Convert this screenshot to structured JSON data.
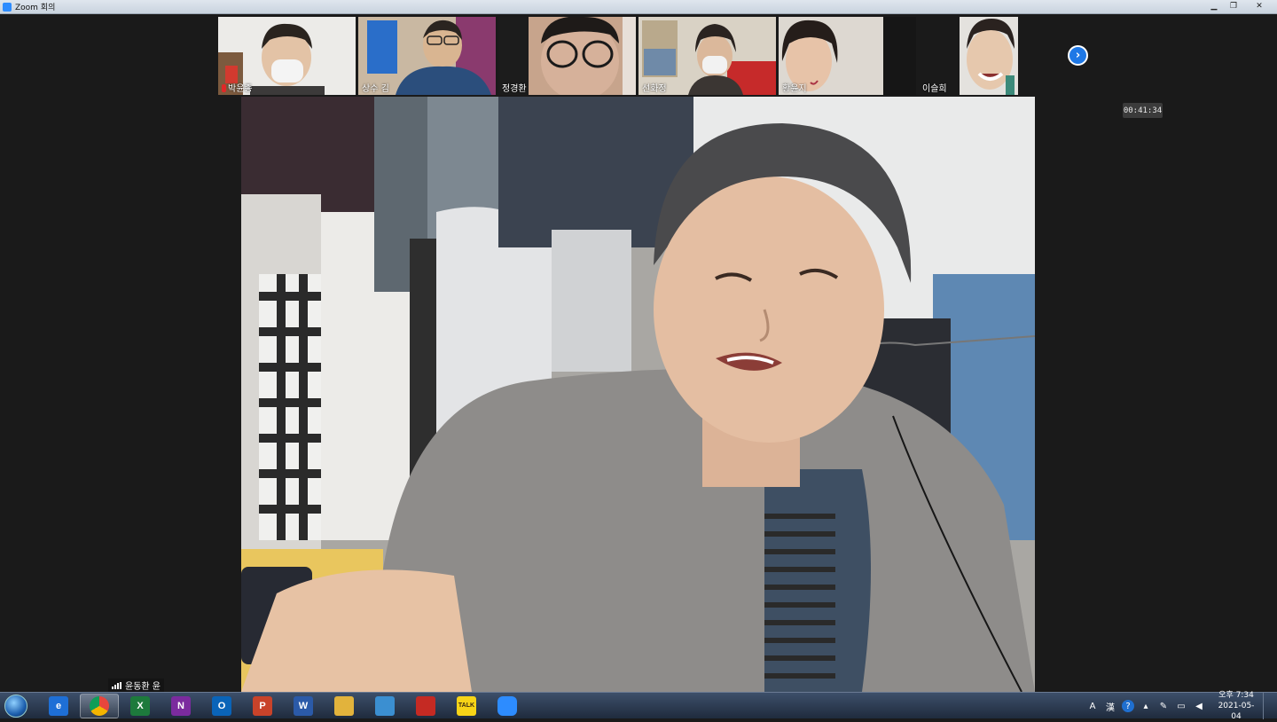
{
  "window": {
    "title": "Zoom 회의"
  },
  "participants": [
    {
      "name": "박윤종",
      "muted": true
    },
    {
      "name": "상수 김",
      "muted": false
    },
    {
      "name": "정경환",
      "muted": false
    },
    {
      "name": "선화정",
      "muted": false
    },
    {
      "name": "황윤지",
      "muted": false
    },
    {
      "name": "이슬희",
      "muted": false
    }
  ],
  "meeting": {
    "elapsed": "00:41:34"
  },
  "active_speaker": {
    "name": "윤동환 윤"
  },
  "taskbar": {
    "apps": [
      {
        "icon": "internet-explorer-icon",
        "label": "e",
        "color": "#1e6fd6"
      },
      {
        "icon": "chrome-icon",
        "label": "",
        "color": "#e8453c"
      },
      {
        "icon": "excel-icon",
        "label": "X",
        "color": "#1d7a3c"
      },
      {
        "icon": "onenote-icon",
        "label": "N",
        "color": "#7b2b9e"
      },
      {
        "icon": "outlook-icon",
        "label": "O",
        "color": "#0a64b8"
      },
      {
        "icon": "powerpoint-icon",
        "label": "P",
        "color": "#c8432a"
      },
      {
        "icon": "word-icon",
        "label": "W",
        "color": "#2b5aa8"
      },
      {
        "icon": "file-explorer-icon",
        "label": "",
        "color": "#e2b33c"
      },
      {
        "icon": "task-app-icon",
        "label": "",
        "color": "#3b8fd1"
      },
      {
        "icon": "acrobat-icon",
        "label": "",
        "color": "#c52a23"
      },
      {
        "icon": "kakaotalk-icon",
        "label": "TALK",
        "color": "#f7d417"
      },
      {
        "icon": "zoom-icon",
        "label": "",
        "color": "#2d8cff"
      }
    ],
    "clock_period": "오후",
    "clock_time": "7:34",
    "clock_date": "2021-05-04"
  }
}
